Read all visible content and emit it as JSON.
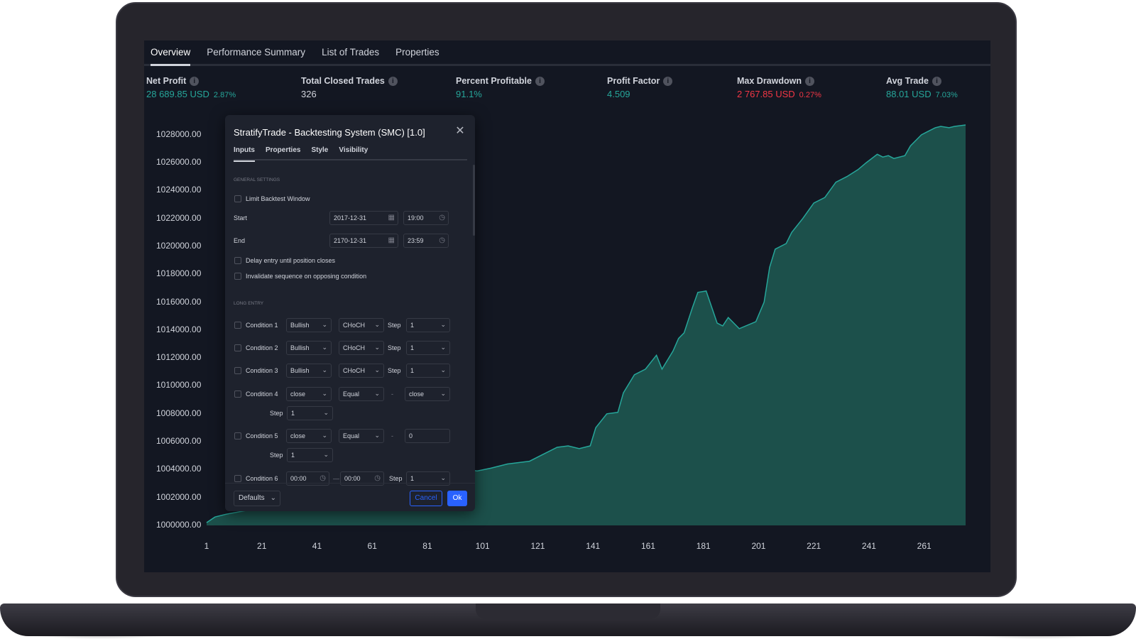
{
  "tabs": [
    "Overview",
    "Performance Summary",
    "List of Trades",
    "Properties"
  ],
  "metrics": [
    {
      "label": "Net Profit",
      "value": "28 689.85 USD",
      "percent": "2.87%",
      "color": "green"
    },
    {
      "label": "Total Closed Trades",
      "value": "326",
      "percent": "",
      "color": "white"
    },
    {
      "label": "Percent Profitable",
      "value": "91.1%",
      "percent": "",
      "color": "green"
    },
    {
      "label": "Profit Factor",
      "value": "4.509",
      "percent": "",
      "color": "green"
    },
    {
      "label": "Max Drawdown",
      "value": "2 767.85 USD",
      "percent": "0.27%",
      "color": "red"
    },
    {
      "label": "Avg Trade",
      "value": "88.01 USD",
      "percent": "7.03%",
      "color": "green"
    }
  ],
  "dialog": {
    "title": "StratifyTrade - Backtesting System (SMC) [1.0]",
    "tabs": [
      "Inputs",
      "Properties",
      "Style",
      "Visibility"
    ],
    "general_settings": "GENERAL SETTINGS",
    "limit_backtest": "Limit Backtest Window",
    "start_label": "Start",
    "start_date": "2017-12-31",
    "start_time": "19:00",
    "end_label": "End",
    "end_date": "2170-12-31",
    "end_time": "23:59",
    "delay_entry": "Delay entry until position closes",
    "invalidate_seq": "Invalidate sequence on opposing condition",
    "long_entry": "LONG ENTRY",
    "conditions": [
      {
        "label": "Condition 1",
        "a": "Bullish",
        "b": "CHoCH",
        "step_label": "Step",
        "step": "1"
      },
      {
        "label": "Condition 2",
        "a": "Bullish",
        "b": "CHoCH",
        "step_label": "Step",
        "step": "1"
      },
      {
        "label": "Condition 3",
        "a": "Bullish",
        "b": "CHoCH",
        "step_label": "Step",
        "step": "1"
      }
    ],
    "condition4": {
      "label": "Condition 4",
      "a": "close",
      "b": "Equal",
      "dash": "-",
      "c": "close",
      "step_label": "Step",
      "step": "1"
    },
    "condition5": {
      "label": "Condition 5",
      "a": "close",
      "b": "Equal",
      "dash": "-",
      "c": "0",
      "step_label": "Step",
      "step": "1"
    },
    "condition6": {
      "label": "Condition 6",
      "a": "00:00",
      "dash": "—",
      "b": "00:00",
      "step_label": "Step",
      "step": "1"
    },
    "defaults": "Defaults",
    "cancel": "Cancel",
    "ok": "Ok"
  },
  "chart_data": {
    "type": "area",
    "x_ticks": [
      1,
      21,
      41,
      61,
      81,
      101,
      121,
      141,
      161,
      181,
      201,
      221,
      241,
      261
    ],
    "y_ticks": [
      "1028000.00",
      "1026000.00",
      "1024000.00",
      "1022000.00",
      "1020000.00",
      "1018000.00",
      "1016000.00",
      "1014000.00",
      "1012000.00",
      "1010000.00",
      "1008000.00",
      "1006000.00",
      "1004000.00",
      "1002000.00",
      "1000000.00"
    ],
    "ylim": [
      1000000,
      1028700
    ],
    "xlim": [
      1,
      276
    ],
    "line_color": "#26a69a",
    "fill_color": "#1e5a52",
    "x": [
      1,
      4,
      8,
      96,
      99,
      104,
      110,
      118,
      124,
      128,
      132,
      136,
      140,
      142,
      146,
      150,
      152,
      156,
      160,
      164,
      166,
      170,
      172,
      174,
      177,
      179,
      182,
      186,
      188,
      190,
      194,
      200,
      203,
      205,
      207,
      211,
      213,
      217,
      221,
      225,
      229,
      233,
      237,
      240,
      244,
      246,
      248,
      250,
      254,
      256,
      260,
      262,
      265,
      267,
      270,
      272,
      274,
      276
    ],
    "y": [
      1000200,
      1000600,
      1000800,
      1004000,
      1003900,
      1004100,
      1004400,
      1004600,
      1005200,
      1005600,
      1005700,
      1005500,
      1005700,
      1007000,
      1008000,
      1008100,
      1009500,
      1010800,
      1011200,
      1012200,
      1011200,
      1012500,
      1013400,
      1013800,
      1015600,
      1016700,
      1016800,
      1014500,
      1014300,
      1014900,
      1014100,
      1014600,
      1016000,
      1018500,
      1019800,
      1020200,
      1021000,
      1022000,
      1023100,
      1023500,
      1024600,
      1025000,
      1025500,
      1026000,
      1026600,
      1026400,
      1026500,
      1026300,
      1026500,
      1027200,
      1028000,
      1028200,
      1028500,
      1028600,
      1028500,
      1028600,
      1028650,
      1028700
    ]
  }
}
